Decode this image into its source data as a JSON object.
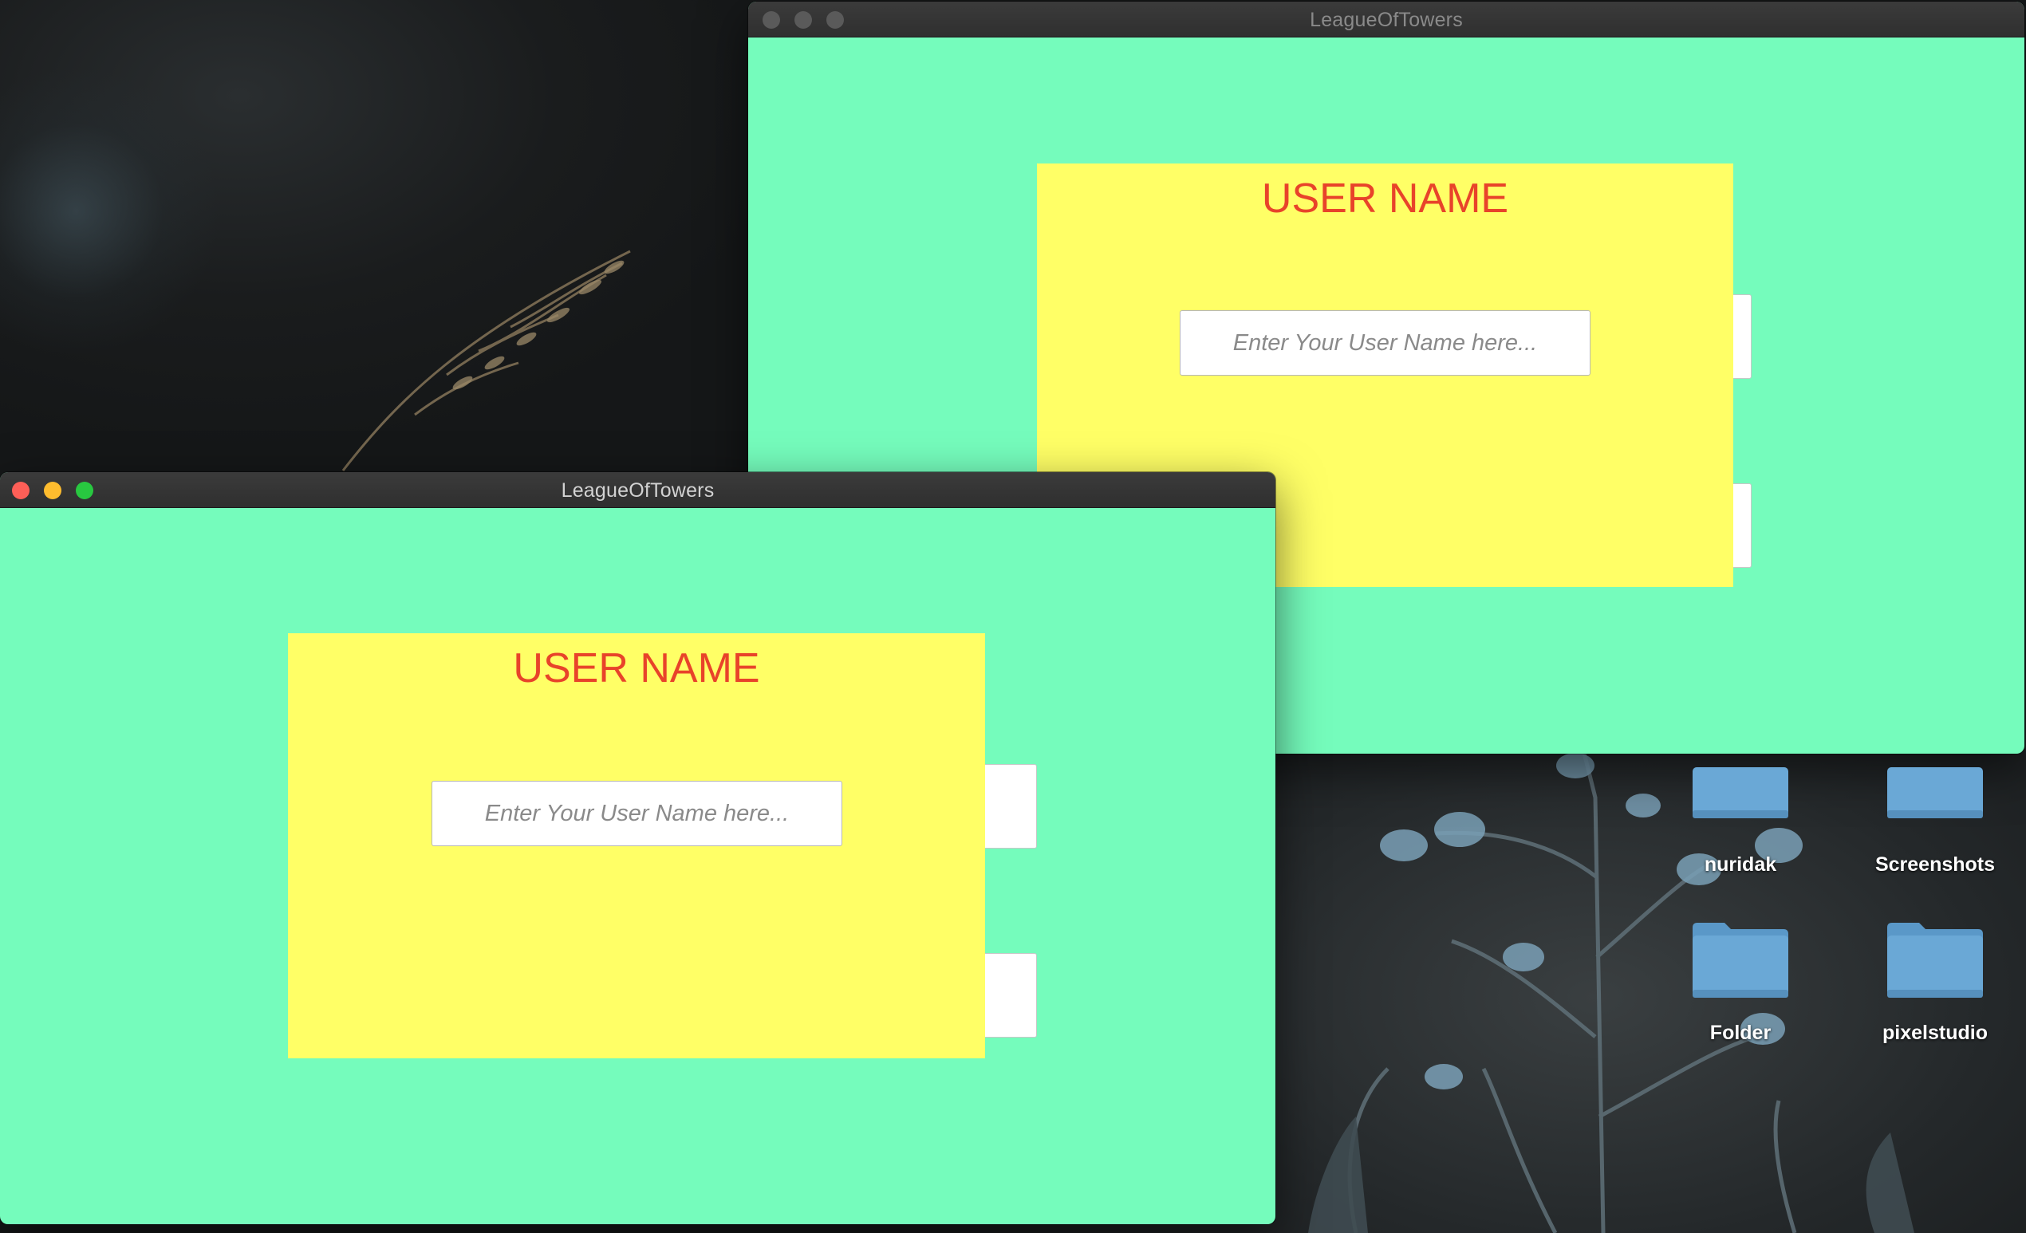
{
  "colors": {
    "window_bg": "#75fcbc",
    "card_bg": "#ffff66",
    "card_title": "#e8432a",
    "titlebar_active_text": "#d2d2d2",
    "titlebar_inactive_text": "#8a8a8a",
    "traffic_close": "#fe5f57",
    "traffic_minimize": "#febc2e",
    "traffic_zoom": "#28c840",
    "traffic_inactive": "#5a5a5a",
    "folder": "#6aa8d6"
  },
  "windows": {
    "back": {
      "title": "LeagueOfTowers",
      "card_title": "USER NAME",
      "input_placeholder": "Enter Your User Name here...",
      "active": false
    },
    "front": {
      "title": "LeagueOfTowers",
      "card_title": "USER NAME",
      "input_placeholder": "Enter Your User Name here...",
      "active": true
    }
  },
  "desktop_icons": [
    {
      "label": "nuridak",
      "icon": "folder-icon"
    },
    {
      "label": "Screenshots",
      "icon": "folder-icon"
    },
    {
      "label": "Folder",
      "icon": "folder-icon"
    },
    {
      "label": "pixelstudio",
      "icon": "folder-icon"
    }
  ]
}
